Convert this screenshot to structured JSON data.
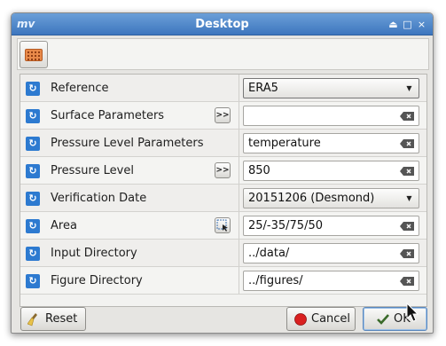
{
  "window": {
    "title": "Desktop",
    "app_icon": "mv",
    "controls": [
      "⏏",
      "□",
      "×"
    ]
  },
  "toolbar": {
    "icon": "grid-icon"
  },
  "rows": [
    {
      "label": "Reference",
      "type": "combo",
      "value": "ERA5",
      "helper": null
    },
    {
      "label": "Surface Parameters",
      "type": "field",
      "value": "",
      "helper": ">>"
    },
    {
      "label": "Pressure Level Parameters",
      "type": "field",
      "value": "temperature",
      "helper": ">>"
    },
    {
      "label": "Pressure Level",
      "type": "field",
      "value": "850",
      "helper": ">>"
    },
    {
      "label": "Verification Date",
      "type": "combo",
      "value": "20151206 (Desmond)",
      "helper": null
    },
    {
      "label": "Area",
      "type": "field",
      "value": "25/-35/75/50",
      "helper": "area-picker"
    },
    {
      "label": "Input Directory",
      "type": "field",
      "value": "../data/",
      "helper": null
    },
    {
      "label": "Figure Directory",
      "type": "field",
      "value": "../figures/",
      "helper": null
    }
  ],
  "footer": {
    "reset_label": "Reset",
    "cancel_label": "Cancel",
    "ok_label": "OK"
  },
  "colors": {
    "titlebar": "#3d76be",
    "accent": "#2d7ad0",
    "cancel_dot": "#d92020"
  }
}
